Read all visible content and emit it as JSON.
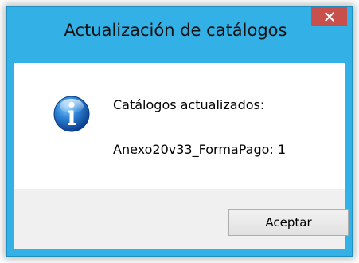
{
  "window": {
    "title": "Actualización de catálogos",
    "close_symbol": "✕",
    "close_icon": "close-icon",
    "frame_color": "#33b0e6",
    "close_color": "#c7504d"
  },
  "message": {
    "icon": "info-icon",
    "line1": "Catálogos actualizados:",
    "line2": "Anexo20v33_FormaPago: 1"
  },
  "buttons": {
    "ok_label": "Aceptar"
  }
}
